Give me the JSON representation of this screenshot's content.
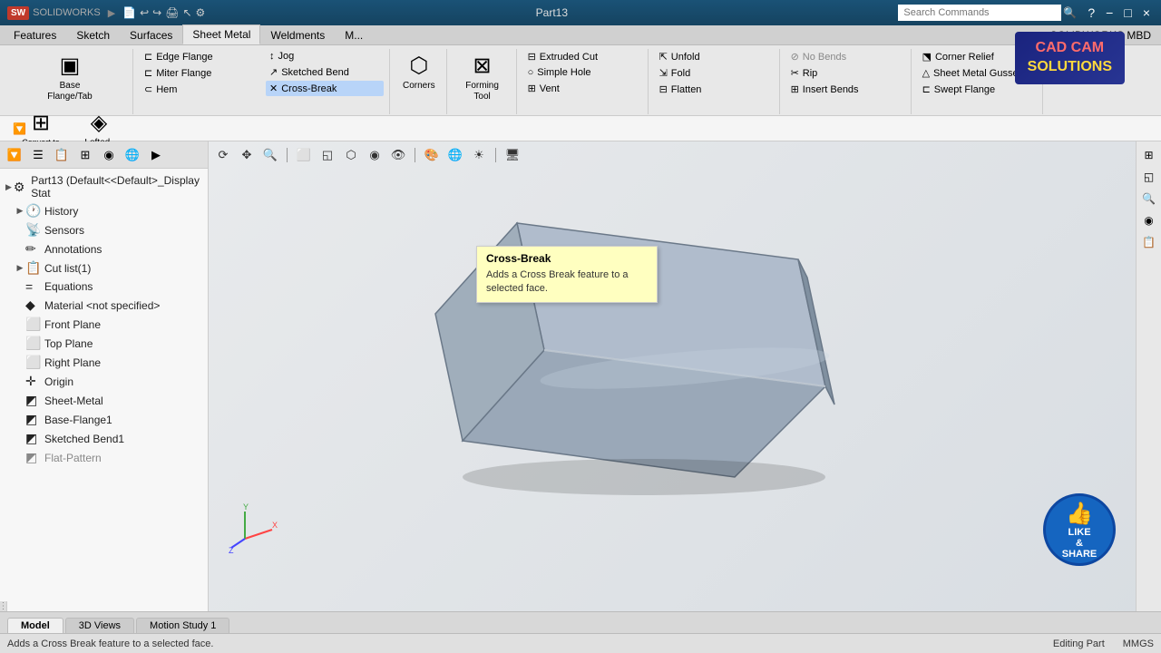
{
  "titleBar": {
    "appName": "SOLIDWORKS",
    "fileName": "Part13",
    "searchPlaceholder": "Search Commands",
    "winControls": [
      "−",
      "□",
      "×"
    ]
  },
  "ribbon": {
    "activeTab": "Sheet Metal",
    "tabs": [
      "Features",
      "Sketch",
      "Surfaces",
      "Sheet Metal",
      "Weldments",
      "M..."
    ],
    "solidworksMBD": "SOLIDWORKS MBD",
    "groups": {
      "left": [
        {
          "id": "base-flange",
          "icon": "▣",
          "label": "Base Flange/Tab"
        },
        {
          "id": "convert-sheet-metal",
          "icon": "⊞",
          "label": "Convert to Sheet Metal"
        },
        {
          "id": "lofted-bend",
          "icon": "◈",
          "label": "Lofted-Bend"
        }
      ],
      "middle1": [
        {
          "id": "edge-flange",
          "icon": "⊏",
          "label": "Edge Flange"
        },
        {
          "id": "miter-flange",
          "icon": "⊏",
          "label": "Miter Flange"
        },
        {
          "id": "hem",
          "icon": "⊂",
          "label": "Hem"
        }
      ],
      "middle2": [
        {
          "id": "jog",
          "icon": "↕",
          "label": "Jog"
        },
        {
          "id": "sketched-bend",
          "icon": "↗",
          "label": "Sketched Bend"
        },
        {
          "id": "cross-break",
          "icon": "✕",
          "label": "Cross-Break"
        }
      ],
      "corners": {
        "icon": "⬡",
        "label": "Corners"
      },
      "forming-tool": {
        "icon": "⊠",
        "label": "Forming Tool"
      },
      "right1": [
        {
          "id": "extruded-cut",
          "icon": "⊟",
          "label": "Extruded Cut"
        },
        {
          "id": "simple-hole",
          "icon": "○",
          "label": "Simple Hole"
        },
        {
          "id": "vent",
          "icon": "⊞",
          "label": "Vent"
        }
      ],
      "right2": [
        {
          "id": "unfold",
          "icon": "⇱",
          "label": "Unfold"
        },
        {
          "id": "fold",
          "icon": "⇲",
          "label": "Fold"
        },
        {
          "id": "flatten",
          "icon": "⊟",
          "label": "Flatten"
        }
      ],
      "right3": [
        {
          "id": "no-bends",
          "icon": "⊘",
          "label": "No Bends"
        },
        {
          "id": "rip",
          "icon": "✂",
          "label": "Rip"
        },
        {
          "id": "insert-bends",
          "icon": "⊞",
          "label": "Insert Bends"
        }
      ],
      "right4": [
        {
          "id": "corner-relief",
          "icon": "⬔",
          "label": "Corner Relief"
        },
        {
          "id": "sheet-metal-gusset",
          "icon": "△",
          "label": "Sheet Metal Gusset"
        },
        {
          "id": "swept-flange",
          "icon": "⊏",
          "label": "Swept Flange"
        }
      ]
    }
  },
  "tooltip": {
    "title": "Cross-Break",
    "description": "Adds a Cross Break feature to a selected face."
  },
  "featureTree": {
    "root": "Part13  (Default<<Default>_Display Stat",
    "items": [
      {
        "id": "history",
        "label": "History",
        "icon": "🕐",
        "hasExpand": true
      },
      {
        "id": "sensors",
        "label": "Sensors",
        "icon": "📡",
        "hasExpand": false
      },
      {
        "id": "annotations",
        "label": "Annotations",
        "icon": "✏️",
        "hasExpand": false
      },
      {
        "id": "cut-list",
        "label": "Cut list(1)",
        "icon": "📋",
        "hasExpand": true
      },
      {
        "id": "equations",
        "label": "Equations",
        "icon": "=",
        "hasExpand": false
      },
      {
        "id": "material",
        "label": "Material <not specified>",
        "icon": "◆",
        "hasExpand": false
      },
      {
        "id": "front-plane",
        "label": "Front Plane",
        "icon": "⬜",
        "hasExpand": false
      },
      {
        "id": "top-plane",
        "label": "Top Plane",
        "icon": "⬜",
        "hasExpand": false
      },
      {
        "id": "right-plane",
        "label": "Right Plane",
        "icon": "⬜",
        "hasExpand": false
      },
      {
        "id": "origin",
        "label": "Origin",
        "icon": "✛",
        "hasExpand": false
      },
      {
        "id": "sheet-metal",
        "label": "Sheet-Metal",
        "icon": "◩",
        "hasExpand": false
      },
      {
        "id": "base-flange1",
        "label": "Base-Flange1",
        "icon": "◩",
        "hasExpand": false
      },
      {
        "id": "sketched-bend1",
        "label": "Sketched Bend1",
        "icon": "◩",
        "hasExpand": false
      },
      {
        "id": "flat-pattern",
        "label": "Flat-Pattern",
        "icon": "◩",
        "greyed": true
      }
    ]
  },
  "viewport": {
    "toolbar": [
      "🔄",
      "🔍",
      "✂",
      "⬜",
      "◱",
      "⬡",
      "◉",
      "⊞",
      "🌐",
      "☀"
    ]
  },
  "bottomTabs": [
    {
      "id": "model",
      "label": "Model",
      "active": true
    },
    {
      "id": "3d-views",
      "label": "3D Views",
      "active": false
    },
    {
      "id": "motion-study",
      "label": "Motion Study 1",
      "active": false
    }
  ],
  "statusBar": {
    "message": "Adds a Cross Break feature to a selected face.",
    "right1": "Editing Part",
    "right2": "MMGS"
  },
  "cadcam": {
    "line1": "CAD CAM",
    "line2": "SOLUTIONS"
  },
  "likeShare": {
    "thumb": "👍",
    "text1": "LIKE",
    "text2": "& SHARE"
  }
}
